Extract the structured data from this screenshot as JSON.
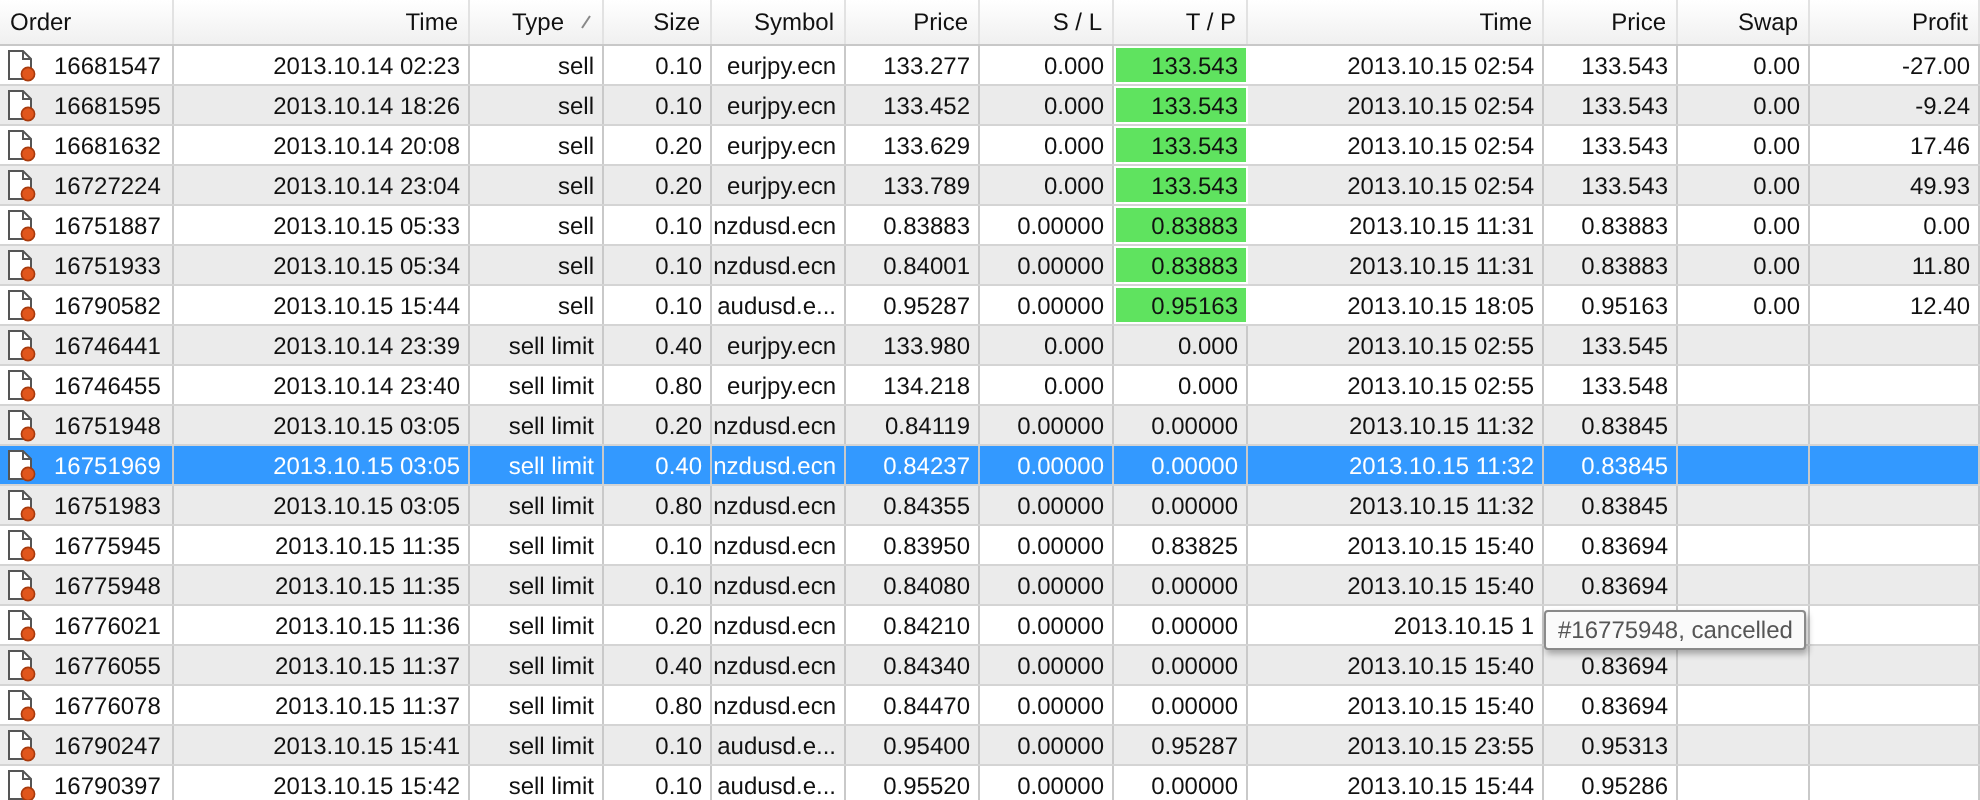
{
  "columns": [
    {
      "label": "Order",
      "sorted": false
    },
    {
      "label": "Time",
      "sorted": false
    },
    {
      "label": "Type",
      "sorted": true
    },
    {
      "label": "Size",
      "sorted": false
    },
    {
      "label": "Symbol",
      "sorted": false
    },
    {
      "label": "Price",
      "sorted": false
    },
    {
      "label": "S / L",
      "sorted": false
    },
    {
      "label": "T / P",
      "sorted": false
    },
    {
      "label": "Time",
      "sorted": false
    },
    {
      "label": "Price",
      "sorted": false
    },
    {
      "label": "Swap",
      "sorted": false
    },
    {
      "label": "Profit",
      "sorted": false
    }
  ],
  "rows": [
    {
      "order": "16681547",
      "time": "2013.10.14 02:23",
      "type": "sell",
      "size": "0.10",
      "symbol": "eurjpy.ecn",
      "price": "133.277",
      "sl": "0.000",
      "tp": "133.543",
      "tp_hit": true,
      "close_time": "2013.10.15 02:54",
      "close_price": "133.543",
      "swap": "0.00",
      "profit": "-27.00",
      "selected": false
    },
    {
      "order": "16681595",
      "time": "2013.10.14 18:26",
      "type": "sell",
      "size": "0.10",
      "symbol": "eurjpy.ecn",
      "price": "133.452",
      "sl": "0.000",
      "tp": "133.543",
      "tp_hit": true,
      "close_time": "2013.10.15 02:54",
      "close_price": "133.543",
      "swap": "0.00",
      "profit": "-9.24",
      "selected": false
    },
    {
      "order": "16681632",
      "time": "2013.10.14 20:08",
      "type": "sell",
      "size": "0.20",
      "symbol": "eurjpy.ecn",
      "price": "133.629",
      "sl": "0.000",
      "tp": "133.543",
      "tp_hit": true,
      "close_time": "2013.10.15 02:54",
      "close_price": "133.543",
      "swap": "0.00",
      "profit": "17.46",
      "selected": false
    },
    {
      "order": "16727224",
      "time": "2013.10.14 23:04",
      "type": "sell",
      "size": "0.20",
      "symbol": "eurjpy.ecn",
      "price": "133.789",
      "sl": "0.000",
      "tp": "133.543",
      "tp_hit": true,
      "close_time": "2013.10.15 02:54",
      "close_price": "133.543",
      "swap": "0.00",
      "profit": "49.93",
      "selected": false
    },
    {
      "order": "16751887",
      "time": "2013.10.15 05:33",
      "type": "sell",
      "size": "0.10",
      "symbol": "nzdusd.ecn",
      "price": "0.83883",
      "sl": "0.00000",
      "tp": "0.83883",
      "tp_hit": true,
      "close_time": "2013.10.15 11:31",
      "close_price": "0.83883",
      "swap": "0.00",
      "profit": "0.00",
      "selected": false
    },
    {
      "order": "16751933",
      "time": "2013.10.15 05:34",
      "type": "sell",
      "size": "0.10",
      "symbol": "nzdusd.ecn",
      "price": "0.84001",
      "sl": "0.00000",
      "tp": "0.83883",
      "tp_hit": true,
      "close_time": "2013.10.15 11:31",
      "close_price": "0.83883",
      "swap": "0.00",
      "profit": "11.80",
      "selected": false
    },
    {
      "order": "16790582",
      "time": "2013.10.15 15:44",
      "type": "sell",
      "size": "0.10",
      "symbol": "audusd.e...",
      "price": "0.95287",
      "sl": "0.00000",
      "tp": "0.95163",
      "tp_hit": true,
      "close_time": "2013.10.15 18:05",
      "close_price": "0.95163",
      "swap": "0.00",
      "profit": "12.40",
      "selected": false
    },
    {
      "order": "16746441",
      "time": "2013.10.14 23:39",
      "type": "sell limit",
      "size": "0.40",
      "symbol": "eurjpy.ecn",
      "price": "133.980",
      "sl": "0.000",
      "tp": "0.000",
      "tp_hit": false,
      "close_time": "2013.10.15 02:55",
      "close_price": "133.545",
      "selected": false
    },
    {
      "order": "16746455",
      "time": "2013.10.14 23:40",
      "type": "sell limit",
      "size": "0.80",
      "symbol": "eurjpy.ecn",
      "price": "134.218",
      "sl": "0.000",
      "tp": "0.000",
      "tp_hit": false,
      "close_time": "2013.10.15 02:55",
      "close_price": "133.548",
      "selected": false
    },
    {
      "order": "16751948",
      "time": "2013.10.15 03:05",
      "type": "sell limit",
      "size": "0.20",
      "symbol": "nzdusd.ecn",
      "price": "0.84119",
      "sl": "0.00000",
      "tp": "0.00000",
      "tp_hit": false,
      "close_time": "2013.10.15 11:32",
      "close_price": "0.83845",
      "selected": false
    },
    {
      "order": "16751969",
      "time": "2013.10.15 03:05",
      "type": "sell limit",
      "size": "0.40",
      "symbol": "nzdusd.ecn",
      "price": "0.84237",
      "sl": "0.00000",
      "tp": "0.00000",
      "tp_hit": false,
      "close_time": "2013.10.15 11:32",
      "close_price": "0.83845",
      "selected": true
    },
    {
      "order": "16751983",
      "time": "2013.10.15 03:05",
      "type": "sell limit",
      "size": "0.80",
      "symbol": "nzdusd.ecn",
      "price": "0.84355",
      "sl": "0.00000",
      "tp": "0.00000",
      "tp_hit": false,
      "close_time": "2013.10.15 11:32",
      "close_price": "0.83845",
      "selected": false
    },
    {
      "order": "16775945",
      "time": "2013.10.15 11:35",
      "type": "sell limit",
      "size": "0.10",
      "symbol": "nzdusd.ecn",
      "price": "0.83950",
      "sl": "0.00000",
      "tp": "0.83825",
      "tp_hit": false,
      "close_time": "2013.10.15 15:40",
      "close_price": "0.83694",
      "selected": false
    },
    {
      "order": "16775948",
      "time": "2013.10.15 11:35",
      "type": "sell limit",
      "size": "0.10",
      "symbol": "nzdusd.ecn",
      "price": "0.84080",
      "sl": "0.00000",
      "tp": "0.00000",
      "tp_hit": false,
      "close_time": "2013.10.15 15:40",
      "close_price": "0.83694",
      "selected": false
    },
    {
      "order": "16776021",
      "time": "2013.10.15 11:36",
      "type": "sell limit",
      "size": "0.20",
      "symbol": "nzdusd.ecn",
      "price": "0.84210",
      "sl": "0.00000",
      "tp": "0.00000",
      "tp_hit": false,
      "close_time": "2013.10.15 1",
      "selected": false
    },
    {
      "order": "16776055",
      "time": "2013.10.15 11:37",
      "type": "sell limit",
      "size": "0.40",
      "symbol": "nzdusd.ecn",
      "price": "0.84340",
      "sl": "0.00000",
      "tp": "0.00000",
      "tp_hit": false,
      "close_time": "2013.10.15 15:40",
      "close_price": "0.83694",
      "selected": false
    },
    {
      "order": "16776078",
      "time": "2013.10.15 11:37",
      "type": "sell limit",
      "size": "0.80",
      "symbol": "nzdusd.ecn",
      "price": "0.84470",
      "sl": "0.00000",
      "tp": "0.00000",
      "tp_hit": false,
      "close_time": "2013.10.15 15:40",
      "close_price": "0.83694",
      "selected": false
    },
    {
      "order": "16790247",
      "time": "2013.10.15 15:41",
      "type": "sell limit",
      "size": "0.10",
      "symbol": "audusd.e...",
      "price": "0.95400",
      "sl": "0.00000",
      "tp": "0.95287",
      "tp_hit": false,
      "close_time": "2013.10.15 23:55",
      "close_price": "0.95313",
      "selected": false
    },
    {
      "order": "16790397",
      "time": "2013.10.15 15:42",
      "type": "sell limit",
      "size": "0.10",
      "symbol": "audusd.e...",
      "price": "0.95520",
      "sl": "0.00000",
      "tp": "0.00000",
      "tp_hit": false,
      "close_time": "2013.10.15 15:44",
      "close_price": "0.95286",
      "selected": false
    }
  ],
  "tooltip": {
    "text": "#16775948, cancelled"
  }
}
